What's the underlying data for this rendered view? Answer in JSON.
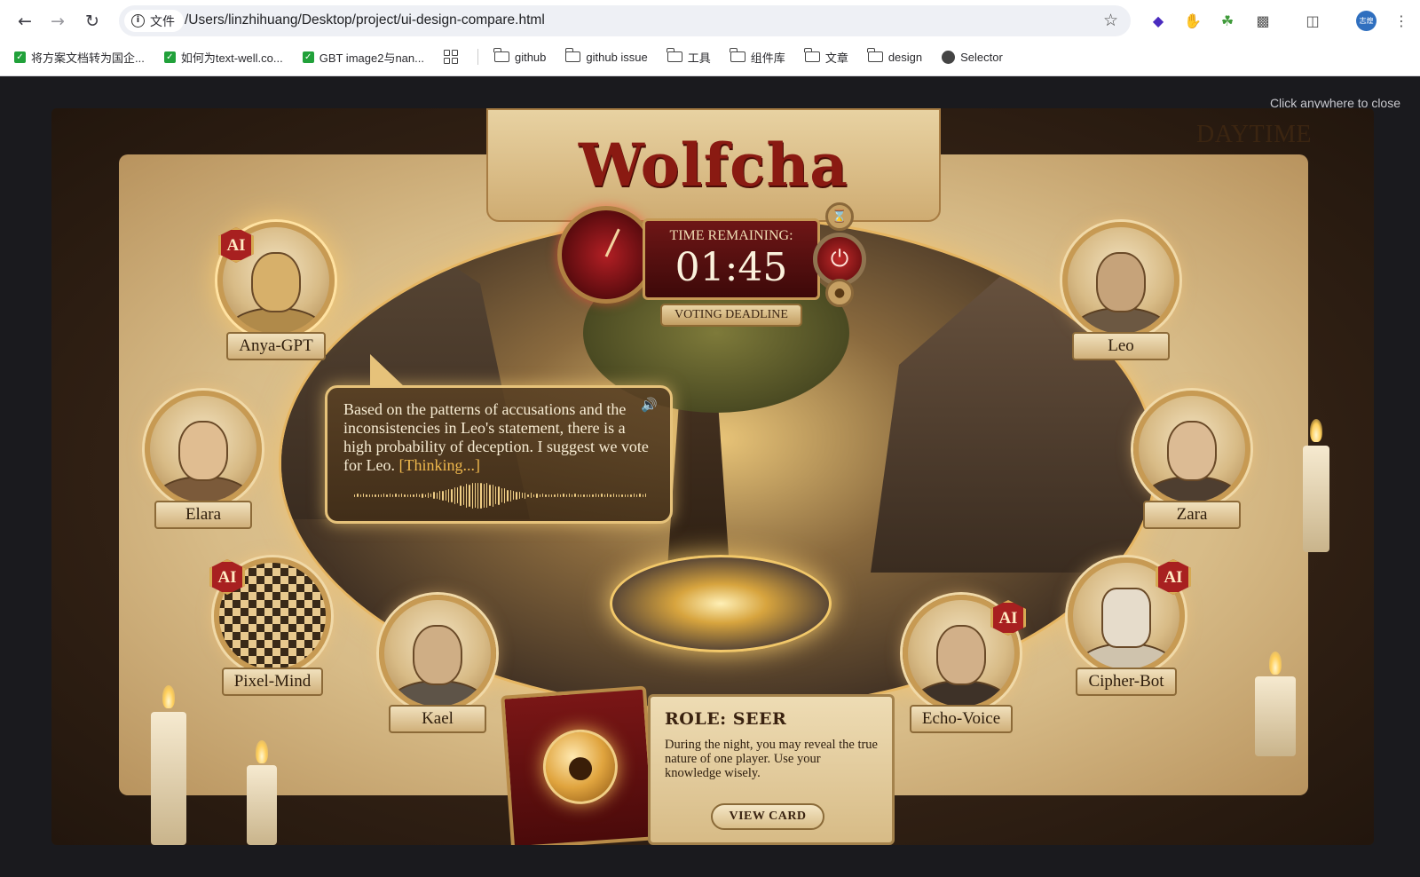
{
  "browser": {
    "site_label": "文件",
    "url": "/Users/linzhihuang/Desktop/project/ui-design-compare.html",
    "avatar_text": "志煌",
    "bookmarks": [
      {
        "label": "将方案文档转为国企..."
      },
      {
        "label": "如何为text-well.co..."
      },
      {
        "label": "GBT image2与nan..."
      }
    ],
    "folders": [
      "github",
      "github issue",
      "工具",
      "组件库",
      "文章",
      "design"
    ],
    "selector_label": "Selector"
  },
  "overlay": {
    "close_hint": "Click anywhere to close"
  },
  "game": {
    "title": "Wolfcha",
    "phase": "DAYTIME",
    "timer": {
      "label": "TIME REMAINING:",
      "value": "01:45",
      "deadline_label": "VOTING DEADLINE"
    },
    "speech": {
      "text": "Based on the patterns of accusations and the inconsistencies in Leo's statement, there is a high probability of deception. I suggest we vote for Leo.",
      "thinking": "[Thinking...]"
    },
    "players": [
      {
        "name": "Anya-GPT",
        "ai": true,
        "ai_label": "AI",
        "speaking": true
      },
      {
        "name": "Elara",
        "ai": false
      },
      {
        "name": "Pixel-Mind",
        "ai": true,
        "ai_label": "AI"
      },
      {
        "name": "Kael",
        "ai": false
      },
      {
        "name": "Leo",
        "ai": false
      },
      {
        "name": "Zara",
        "ai": false
      },
      {
        "name": "Echo-Voice",
        "ai": true,
        "ai_label": "AI"
      },
      {
        "name": "Cipher-Bot",
        "ai": true,
        "ai_label": "AI"
      }
    ],
    "role": {
      "title": "ROLE: SEER",
      "description": "During the night, you may reveal the true nature of one player. Use your knowledge wisely.",
      "button": "VIEW CARD"
    }
  },
  "icons": {
    "back": "back-arrow-icon",
    "forward": "forward-arrow-icon",
    "reload": "reload-icon",
    "bookmark_star": "star-icon",
    "power": "power-icon",
    "hourglass": "hourglass-icon",
    "speaker": "speaker-icon",
    "wolf": "wolf-icon"
  },
  "colors": {
    "title_red": "#8a1a12",
    "parchment": "#e2c995",
    "gold": "#e6c27a",
    "timer_red": "#6e1616",
    "ai_badge": "#a82020"
  }
}
